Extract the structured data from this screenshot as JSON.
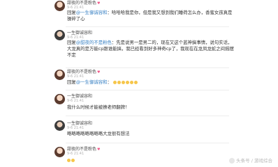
{
  "comments": [
    {
      "name": "甜夜的不是粉色",
      "time": "9-6 21:41",
      "reply_prefix": "回复",
      "reply_user": "@一生御诚容和",
      "text": "哈哈哈我是你，但是我又想到我们睡荷怎么办，香蜜女孩真是操碎了心",
      "actions": ""
    },
    {
      "name": "一生御诚容和",
      "time": "9-6 21:41",
      "reply_prefix": "回复",
      "reply_user": "@甜夜的不是粉色",
      "text": "先是说男一是男二的，现在又这个蓝神搞事情，说句实话，大龙真的是万能cp跟谁能搞，我已经看到好多神奇cp了，我现在在龙凤龙蛇之间摇摆不定",
      "actions": ""
    },
    {
      "name": "甜夜的不是粉色",
      "time": "9-6 21:41",
      "reply_prefix": "回复",
      "reply_user": "@一生御诚容和",
      "text": "",
      "actions": ""
    },
    {
      "name": "一生御诚容和",
      "time": "9-6 21:41",
      "reply_prefix": "",
      "reply_user": "",
      "text": "我什么时候才能被撩老师翻牌！",
      "actions": ""
    },
    {
      "name": "一生御诚容和",
      "time": "9-6 21:41",
      "reply_prefix": "",
      "reply_user": "",
      "text": "略略略略略略略略大龙很有想法",
      "actions": ""
    },
    {
      "name": "甜夜的不是粉色",
      "time": "9-6 21:41",
      "reply_prefix": "",
      "reply_user": "",
      "text": "",
      "actions": ""
    }
  ],
  "watermark": "头条号 / 游戏综合"
}
